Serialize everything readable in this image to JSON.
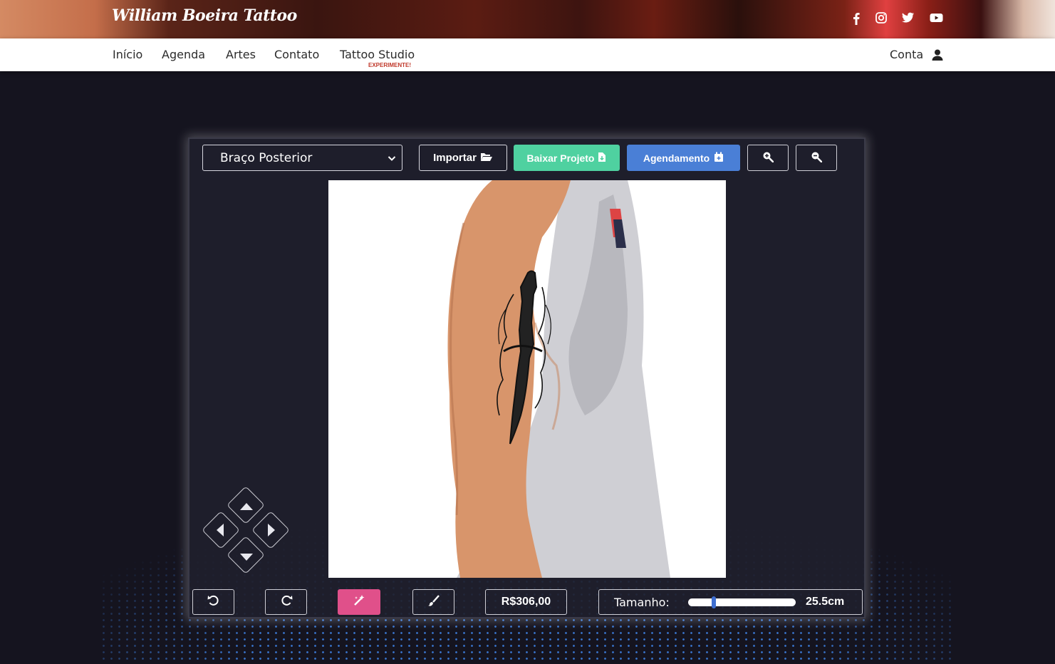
{
  "brand": {
    "logo": "William Boeira Tattoo"
  },
  "social": {
    "icons": [
      "facebook-icon",
      "instagram-icon",
      "twitter-icon",
      "youtube-icon"
    ]
  },
  "nav": {
    "items": [
      {
        "label": "Início"
      },
      {
        "label": "Agenda"
      },
      {
        "label": "Artes"
      },
      {
        "label": "Contato"
      },
      {
        "label": "Tattoo Studio"
      }
    ],
    "studio_badge": "EXPERIMENTE!",
    "account_label": "Conta"
  },
  "toolbar": {
    "body_part_selected": "Braço Posterior",
    "import_label": "Importar",
    "download_label": "Baixar Projeto",
    "schedule_label": "Agendamento",
    "colors": {
      "download": "#4fd1a0",
      "schedule": "#4a7fd6",
      "magic": "#e0508a"
    }
  },
  "bottom": {
    "price": "R$306,00",
    "size_label": "Tamanho:",
    "size_value": "25.5cm",
    "size_fraction": 0.23
  }
}
